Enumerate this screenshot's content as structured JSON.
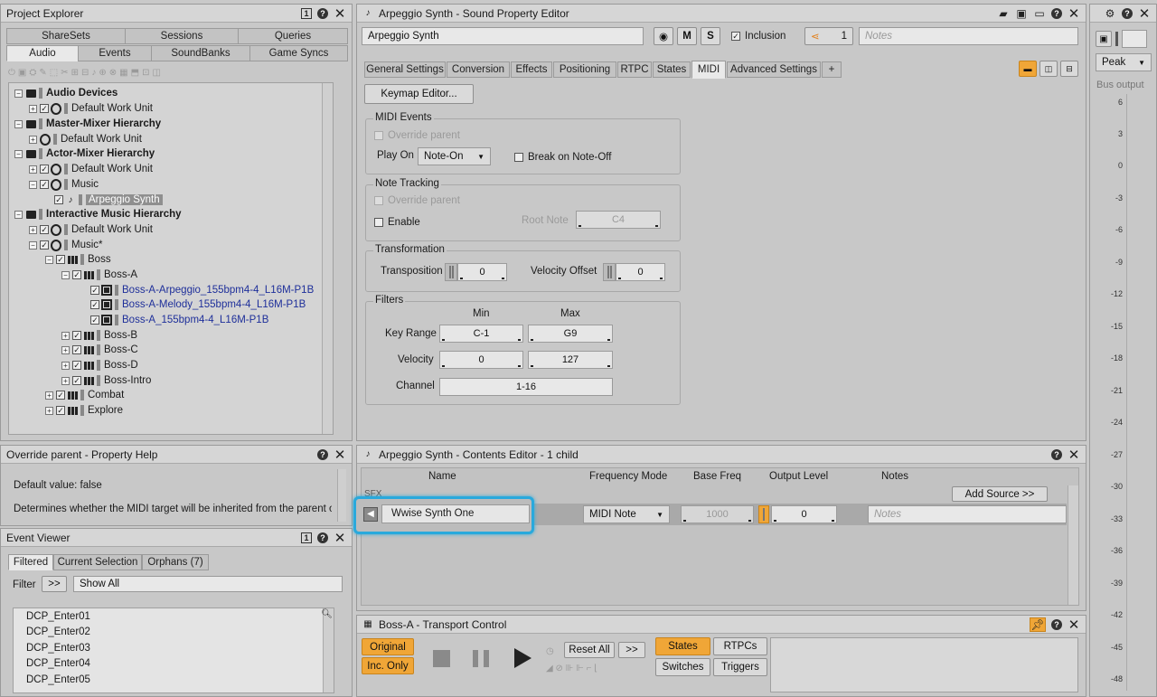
{
  "project_explorer": {
    "title": "Project Explorer",
    "top_tabs": [
      "ShareSets",
      "Sessions",
      "Queries"
    ],
    "bottom_tabs": [
      "Audio",
      "Events",
      "SoundBanks",
      "Game Syncs"
    ],
    "tree": [
      {
        "label": "Audio Devices",
        "bold": true
      },
      {
        "label": "Default Work Unit"
      },
      {
        "label": "Master-Mixer Hierarchy",
        "bold": true
      },
      {
        "label": "Default Work Unit"
      },
      {
        "label": "Actor-Mixer Hierarchy",
        "bold": true
      },
      {
        "label": "Default Work Unit"
      },
      {
        "label": "Music"
      },
      {
        "label": "Arpeggio Synth",
        "selected": true
      },
      {
        "label": "Interactive Music Hierarchy",
        "bold": true
      },
      {
        "label": "Default Work Unit"
      },
      {
        "label": "Music*"
      },
      {
        "label": "Boss"
      },
      {
        "label": "Boss-A"
      },
      {
        "label": "Boss-A-Arpeggio_155bpm4-4_L16M-P1B",
        "link": true
      },
      {
        "label": "Boss-A-Melody_155bpm4-4_L16M-P1B",
        "link": true
      },
      {
        "label": "Boss-A_155bpm4-4_L16M-P1B",
        "link": true
      },
      {
        "label": "Boss-B"
      },
      {
        "label": "Boss-C"
      },
      {
        "label": "Boss-D"
      },
      {
        "label": "Boss-Intro"
      },
      {
        "label": "Combat"
      },
      {
        "label": "Explore"
      }
    ]
  },
  "property_help": {
    "title": "Override parent - Property Help",
    "default_value": "Default value: false",
    "text": "Determines whether the MIDI target will be inherited from the parent or"
  },
  "event_viewer": {
    "title": "Event Viewer",
    "tabs": [
      "Filtered",
      "Current Selection",
      "Orphans (7)"
    ],
    "filter_label": "Filter",
    "filter_button": ">>",
    "filter_value": "Show All",
    "items": [
      "DCP_Enter01",
      "DCP_Enter02",
      "DCP_Enter03",
      "DCP_Enter04",
      "DCP_Enter05"
    ]
  },
  "property_editor": {
    "title": "Arpeggio Synth - Sound Property Editor",
    "name": "Arpeggio Synth",
    "mute": "M",
    "solo": "S",
    "inclusion": "Inclusion",
    "ref_count": "1",
    "notes_placeholder": "Notes",
    "tabs": [
      "General Settings",
      "Conversion",
      "Effects",
      "Positioning",
      "RTPC",
      "States",
      "MIDI",
      "Advanced Settings",
      "+"
    ],
    "keymap_button": "Keymap Editor...",
    "midi_events": {
      "title": "MIDI Events",
      "override": "Override parent",
      "play_on_label": "Play On",
      "play_on_value": "Note-On",
      "break_label": "Break on Note-Off"
    },
    "note_tracking": {
      "title": "Note Tracking",
      "override": "Override parent",
      "enable": "Enable",
      "root_note_label": "Root Note",
      "root_note_value": "C4"
    },
    "transformation": {
      "title": "Transformation",
      "transposition_label": "Transposition",
      "transposition_value": "0",
      "velocity_offset_label": "Velocity Offset",
      "velocity_offset_value": "0"
    },
    "filters": {
      "title": "Filters",
      "min_header": "Min",
      "max_header": "Max",
      "key_range_label": "Key Range",
      "key_min": "C-1",
      "key_max": "G9",
      "velocity_label": "Velocity",
      "vel_min": "0",
      "vel_max": "127",
      "channel_label": "Channel",
      "channel_value": "1-16"
    }
  },
  "contents_editor": {
    "title": "Arpeggio Synth - Contents Editor - 1 child",
    "columns": [
      "Name",
      "Frequency Mode",
      "Base Freq",
      "Output Level",
      "Notes"
    ],
    "section": "SFX",
    "add_source": "Add Source >>",
    "row": {
      "name": "Wwise Synth One",
      "frequency_mode": "MIDI Note",
      "base_freq": "1000",
      "output_level": "0",
      "notes_placeholder": "Notes"
    }
  },
  "transport": {
    "title": "Boss-A - Transport Control",
    "original": "Original",
    "inc_only": "Inc. Only",
    "reset_all": "Reset All",
    "more": ">>",
    "states": "States",
    "rtpcs": "RTPCs",
    "switches": "Switches",
    "triggers": "Triggers"
  },
  "meter": {
    "mode": "Peak",
    "label": "Bus output",
    "ticks": [
      "6",
      "3",
      "0",
      "-3",
      "-6",
      "-9",
      "-12",
      "-15",
      "-18",
      "-21",
      "-24",
      "-27",
      "-30",
      "-33",
      "-36",
      "-39",
      "-42",
      "-45",
      "-48"
    ]
  },
  "colors": {
    "accent": "#f0a637",
    "highlight": "#29a9dc",
    "link": "#1e2f9a"
  }
}
